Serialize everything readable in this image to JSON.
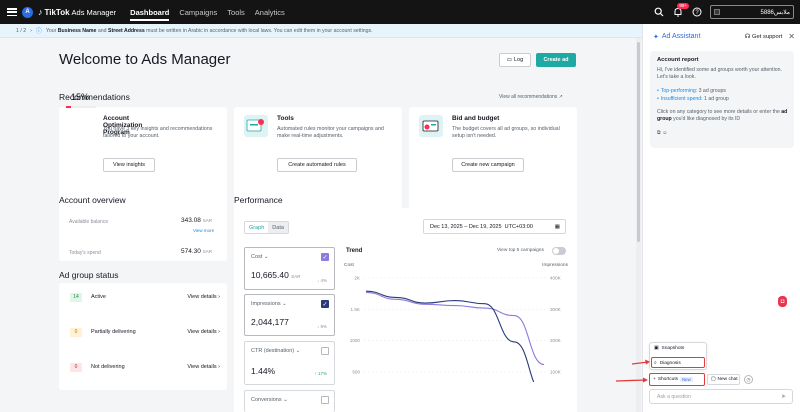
{
  "topbar": {
    "account_initial": "A",
    "logo": "TikTok",
    "logo_sub": "Ads Manager",
    "tabs": [
      "Dashboard",
      "Campaigns",
      "Tools",
      "Analytics"
    ],
    "notification_count": "99+",
    "account_name": "ملابس5886"
  },
  "notice": {
    "pager": "1 / 2",
    "text_pre": "Your",
    "bold1": "Business Name",
    "mid": "and",
    "bold2": "Street Address",
    "text_post": "must be written in Arabic in accordance with local laws. You can edit them in your account settings."
  },
  "page": {
    "title": "Welcome to Ads Manager",
    "log_label": "Log",
    "create_label": "Create ad"
  },
  "recommendations": {
    "title": "Recommendations",
    "view_all": "View all recommendations",
    "cards": [
      {
        "percent": "15%",
        "percent_value": 15,
        "title": "Account Optimization Program",
        "text": "You have 3 key insights and recommendations tailored to your account.",
        "button": "View insights"
      },
      {
        "title": "Tools",
        "text": "Automated rules monitor your campaigns and make real-time adjustments.",
        "button": "Create automated rules"
      },
      {
        "title": "Bid and budget",
        "text": "The budget covers all ad groups, so individual setup isn't needed.",
        "button": "Create new campaign"
      }
    ]
  },
  "overview": {
    "title": "Account overview",
    "balance_label": "Available balance",
    "balance_value": "343.08",
    "currency": "SAR",
    "view_more": "View more",
    "spend_label": "Today's spend",
    "spend_value": "574.30"
  },
  "ad_group_status": {
    "title": "Ad group status",
    "details_label": "View details",
    "rows": [
      {
        "count": "14",
        "label": "Active",
        "color": "#e3f5e9",
        "text_color": "#1a8a47"
      },
      {
        "count": "0",
        "label": "Partially delivering",
        "color": "#fff1d6",
        "text_color": "#b87a00"
      },
      {
        "count": "0",
        "label": "Not delivering",
        "color": "#fde4e6",
        "text_color": "#c8283a"
      }
    ]
  },
  "performance": {
    "title": "Performance",
    "toggle": [
      "Graph",
      "Data"
    ],
    "date_range": "Dec 13, 2025 – Dec 19, 2025",
    "timezone": "UTC+03:00",
    "metrics": [
      {
        "name": "Cost",
        "value": "10,665.40",
        "unit": "SAR",
        "delta": "4%",
        "direction": "down",
        "checked": true,
        "color": "#8c7cdb"
      },
      {
        "name": "Impressions",
        "value": "2,044,177",
        "unit": "",
        "delta": "9%",
        "direction": "down",
        "checked": true,
        "color": "#2b3b7a"
      },
      {
        "name": "CTR (destination)",
        "value": "1.44%",
        "unit": "",
        "delta": "17%",
        "direction": "up",
        "checked": false,
        "color": ""
      },
      {
        "name": "Conversions",
        "value": "",
        "unit": "",
        "delta": "",
        "direction": "",
        "checked": false,
        "color": ""
      }
    ],
    "trend_title": "Trend",
    "top5_label": "View top 5 campaigns",
    "left_axis_label": "Cost",
    "right_axis_label": "Impressions"
  },
  "chart_data": {
    "type": "line",
    "left_ticks": [
      "2K",
      "1.5K",
      "1000",
      "500"
    ],
    "right_ticks": [
      "400K",
      "300K",
      "200K",
      "100K"
    ],
    "x": [
      "Dec 13",
      "Dec 14",
      "Dec 15",
      "Dec 16",
      "Dec 17",
      "Dec 18",
      "Dec 19"
    ],
    "series": [
      {
        "name": "Cost",
        "axis": "left",
        "color": "#8c7cdb",
        "values": [
          1770,
          1660,
          1580,
          1560,
          1520,
          1400,
          620
        ]
      },
      {
        "name": "Impressions",
        "axis": "right",
        "color": "#2b3b7a",
        "values": [
          358000,
          338000,
          320000,
          328000,
          318000,
          196000,
          30000
        ]
      }
    ],
    "left_range": [
      400,
      2100
    ],
    "right_range": [
      0,
      420000
    ]
  },
  "assistant": {
    "title": "Ad Assistant",
    "support": "Get support",
    "report_title": "Account report",
    "intro": "Hi, I've identified some ad groups worth your attention. Let's take a look.",
    "items": [
      {
        "label": "Top-performing",
        "value": "3 ad groups"
      },
      {
        "label": "Insufficient spend",
        "value": "1 ad group"
      }
    ],
    "outro_pre": "Click on any category to see more details or enter the",
    "outro_bold": "ad group",
    "outro_post": "you'd like diagnosed by its ID",
    "menu": [
      "Snapshots",
      "Diagnosis"
    ],
    "shortcuts": "Shortcuts",
    "new_tag": "New",
    "new_chat": "New chat",
    "input_placeholder": "Ask a question"
  }
}
